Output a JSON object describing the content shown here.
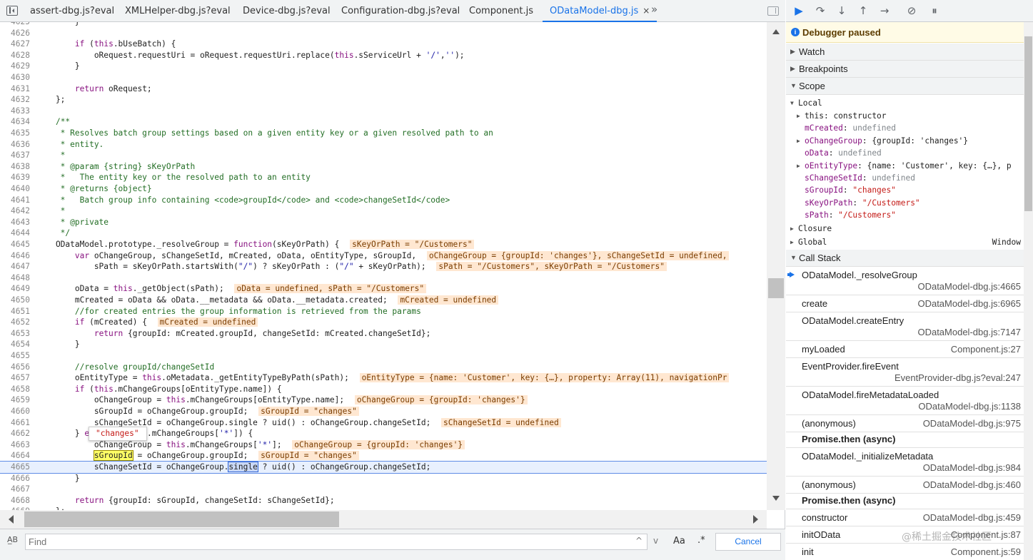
{
  "tabs": [
    {
      "label": "assert-dbg.js?eval",
      "active": false
    },
    {
      "label": "XMLHelper-dbg.js?eval",
      "active": false
    },
    {
      "label": "Device-dbg.js?eval",
      "active": false
    },
    {
      "label": "Configuration-dbg.js?eval",
      "active": false
    },
    {
      "label": "Component.js",
      "active": false
    },
    {
      "label": "ODataModel-dbg.js",
      "active": true,
      "close": "×"
    }
  ],
  "more_tabs": "»",
  "code_lines": [
    {
      "n": "4625",
      "html": "        }"
    },
    {
      "n": "4626",
      "html": ""
    },
    {
      "n": "4627",
      "html": "        <span class='kw'>if</span> (<span class='kw'>this</span>.bUseBatch) {"
    },
    {
      "n": "4628",
      "html": "            oRequest.requestUri = oRequest.requestUri.replace(<span class='kw'>this</span>.sServiceUrl + <span class='str'>'/'</span>,<span class='str'>''</span>);"
    },
    {
      "n": "4629",
      "html": "        }"
    },
    {
      "n": "4630",
      "html": ""
    },
    {
      "n": "4631",
      "html": "        <span class='kw'>return</span> oRequest;"
    },
    {
      "n": "4632",
      "html": "    };"
    },
    {
      "n": "4633",
      "html": ""
    },
    {
      "n": "4634",
      "html": "    <span class='cm'>/**</span>"
    },
    {
      "n": "4635",
      "html": "<span class='cm'>     * Resolves batch group settings based on a given entity key or a given resolved path to an</span>"
    },
    {
      "n": "4636",
      "html": "<span class='cm'>     * entity.</span>"
    },
    {
      "n": "4637",
      "html": "<span class='cm'>     *</span>"
    },
    {
      "n": "4638",
      "html": "<span class='cm'>     * @param {string} sKeyOrPath</span>"
    },
    {
      "n": "4639",
      "html": "<span class='cm'>     *   The entity key or the resolved path to an entity</span>"
    },
    {
      "n": "4640",
      "html": "<span class='cm'>     * @returns {object}</span>"
    },
    {
      "n": "4641",
      "html": "<span class='cm'>     *   Batch group info containing &lt;code&gt;groupId&lt;/code&gt; and &lt;code&gt;changeSetId&lt;/code&gt;</span>"
    },
    {
      "n": "4642",
      "html": "<span class='cm'>     *</span>"
    },
    {
      "n": "4643",
      "html": "<span class='cm'>     * @private</span>"
    },
    {
      "n": "4644",
      "html": "<span class='cm'>     */</span>"
    },
    {
      "n": "4645",
      "html": "    ODataModel.prototype._resolveGroup = <span class='kw'>function</span>(sKeyOrPath) { <span class='inl'>sKeyOrPath = \"/Customers\"</span>"
    },
    {
      "n": "4646",
      "html": "        <span class='kw'>var</span> oChangeGroup, sChangeSetId, mCreated, oData, oEntityType, sGroupId, <span class='inl'>oChangeGroup = {groupId: 'changes'}, sChangeSetId = undefined,</span>"
    },
    {
      "n": "4647",
      "html": "            sPath = sKeyOrPath.startsWith(<span class='str'>\"/\"</span>) ? sKeyOrPath : (<span class='str'>\"/\"</span> + sKeyOrPath); <span class='inl'>sPath = \"/Customers\", sKeyOrPath = \"/Customers\"</span>"
    },
    {
      "n": "4648",
      "html": ""
    },
    {
      "n": "4649",
      "html": "        oData = <span class='kw'>this</span>._getObject(sPath); <span class='inl'>oData = undefined, sPath = \"/Customers\"</span>"
    },
    {
      "n": "4650",
      "html": "        mCreated = oData &amp;&amp; oData.__metadata &amp;&amp; oData.__metadata.created; <span class='inl'>mCreated = undefined</span>"
    },
    {
      "n": "4651",
      "html": "        <span class='cm'>//for created entries the group information is retrieved from the params</span>"
    },
    {
      "n": "4652",
      "html": "        <span class='kw'>if</span> (mCreated) { <span class='inl'>mCreated = undefined</span>"
    },
    {
      "n": "4653",
      "html": "            <span class='kw'>return</span> {groupId: mCreated.groupId, changeSetId: mCreated.changeSetId};"
    },
    {
      "n": "4654",
      "html": "        }"
    },
    {
      "n": "4655",
      "html": ""
    },
    {
      "n": "4656",
      "html": "        <span class='cm'>//resolve groupId/changeSetId</span>"
    },
    {
      "n": "4657",
      "html": "        oEntityType = <span class='kw'>this</span>.oMetadata._getEntityTypeByPath(sPath); <span class='inl'>oEntityType = {name: 'Customer', key: {…}, property: Array(11), navigationPr</span>"
    },
    {
      "n": "4658",
      "html": "        <span class='kw'>if</span> (<span class='kw'>this</span>.mChangeGroups[oEntityType.name]) {"
    },
    {
      "n": "4659",
      "html": "            oChangeGroup = <span class='kw'>this</span>.mChangeGroups[oEntityType.name]; <span class='inl'>oChangeGroup = {groupId: 'changes'}</span>"
    },
    {
      "n": "4660",
      "html": "            sGroupId = oChangeGroup.groupId; <span class='inl'>sGroupId = \"changes\"</span>"
    },
    {
      "n": "4661",
      "html": "            sChangeSetId = oChangeGroup.single ? uid() : oChangeGroup.changeSetId; <span class='inl'>sChangeSetId = undefined</span>"
    },
    {
      "n": "4662",
      "html": "        } <span class='kw'>else</span> <span class='kw'>if</span> (<span class='kw'>this</span>.mChangeGroups[<span class='str'>'*'</span>]) {"
    },
    {
      "n": "4663",
      "html": "            oChangeGroup = <span class='kw'>this</span>.mChangeGroups[<span class='str'>'*'</span>]; <span class='inl'>oChangeGroup = {groupId: 'changes'}</span>"
    },
    {
      "n": "4664",
      "html": "            <span class='hl-yellow'>sGroupId</span> = oChangeGroup.groupId; <span class='inl'>sGroupId = \"changes\"</span>"
    },
    {
      "n": "4665",
      "html": "            sChangeSetId = oChangeGroup.<span class='hl-sel'>single</span> ? uid() : oChangeGroup.changeSetId;",
      "exec": true
    },
    {
      "n": "4666",
      "html": "        }"
    },
    {
      "n": "4667",
      "html": ""
    },
    {
      "n": "4668",
      "html": "        <span class='kw'>return</span> {groupId: sGroupId, changeSetId: sChangeSetId};"
    },
    {
      "n": "4669",
      "html": "    };"
    }
  ],
  "hover_tooltip": "\"changes\"",
  "find": {
    "placeholder": "Find",
    "match_case": "Aa",
    "regex": ".*",
    "cancel": "Cancel",
    "case_icon": "A̲B",
    "prev": "^",
    "next": "v"
  },
  "debugger": {
    "paused_message": "Debugger paused",
    "sections": {
      "watch": "Watch",
      "breakpoints": "Breakpoints",
      "scope": "Scope",
      "call_stack": "Call Stack"
    },
    "scope": {
      "local_label": "Local",
      "entries": [
        {
          "name": "this",
          "value": "constructor",
          "kind": "obj",
          "expandable": true,
          "plain": true
        },
        {
          "name": "mCreated",
          "value": "undefined",
          "kind": "undef",
          "expandable": false
        },
        {
          "name": "oChangeGroup",
          "value": "{groupId: 'changes'}",
          "kind": "obj",
          "expandable": true
        },
        {
          "name": "oData",
          "value": "undefined",
          "kind": "undef",
          "expandable": false
        },
        {
          "name": "oEntityType",
          "value": "{name: 'Customer', key: {…}, p",
          "kind": "obj",
          "expandable": true
        },
        {
          "name": "sChangeSetId",
          "value": "undefined",
          "kind": "undef",
          "expandable": false
        },
        {
          "name": "sGroupId",
          "value": "\"changes\"",
          "kind": "str",
          "expandable": false
        },
        {
          "name": "sKeyOrPath",
          "value": "\"/Customers\"",
          "kind": "str",
          "expandable": false
        },
        {
          "name": "sPath",
          "value": "\"/Customers\"",
          "kind": "str",
          "expandable": false
        }
      ],
      "closure_label": "Closure",
      "global_label": "Global",
      "global_value": "Window"
    },
    "call_stack": [
      {
        "fn": "ODataModel._resolveGroup",
        "loc": "ODataModel-dbg.js:4665",
        "current": true,
        "two_line": true
      },
      {
        "fn": "create",
        "loc": "ODataModel-dbg.js:6965",
        "two_line": false
      },
      {
        "fn": "ODataModel.createEntry",
        "loc": "ODataModel-dbg.js:7147",
        "two_line": true
      },
      {
        "fn": "myLoaded",
        "loc": "Component.js:27",
        "two_line": false
      },
      {
        "fn": "EventProvider.fireEvent",
        "loc": "EventProvider-dbg.js?eval:247",
        "two_line": true
      },
      {
        "fn": "ODataModel.fireMetadataLoaded",
        "loc": "ODataModel-dbg.js:1138",
        "two_line": true
      },
      {
        "fn": "(anonymous)",
        "loc": "ODataModel-dbg.js:975",
        "two_line": false
      },
      {
        "fn": "Promise.then (async)",
        "loc": "",
        "async": true
      },
      {
        "fn": "ODataModel._initializeMetadata",
        "loc": "ODataModel-dbg.js:984",
        "two_line": true
      },
      {
        "fn": "(anonymous)",
        "loc": "ODataModel-dbg.js:460",
        "two_line": false
      },
      {
        "fn": "Promise.then (async)",
        "loc": "",
        "async": true
      },
      {
        "fn": "constructor",
        "loc": "ODataModel-dbg.js:459",
        "two_line": false
      },
      {
        "fn": "initOData",
        "loc": "Component.js:87",
        "two_line": false
      },
      {
        "fn": "init",
        "loc": "Component.js:59",
        "two_line": false
      }
    ]
  },
  "watermark": "@稀土掘金技术社区",
  "colors": {
    "accent": "#1a73e8",
    "paused_bg": "#fffbe6",
    "inline_value_bg": "#ffe7d1",
    "exec_line_bg": "#e8f0fe"
  }
}
